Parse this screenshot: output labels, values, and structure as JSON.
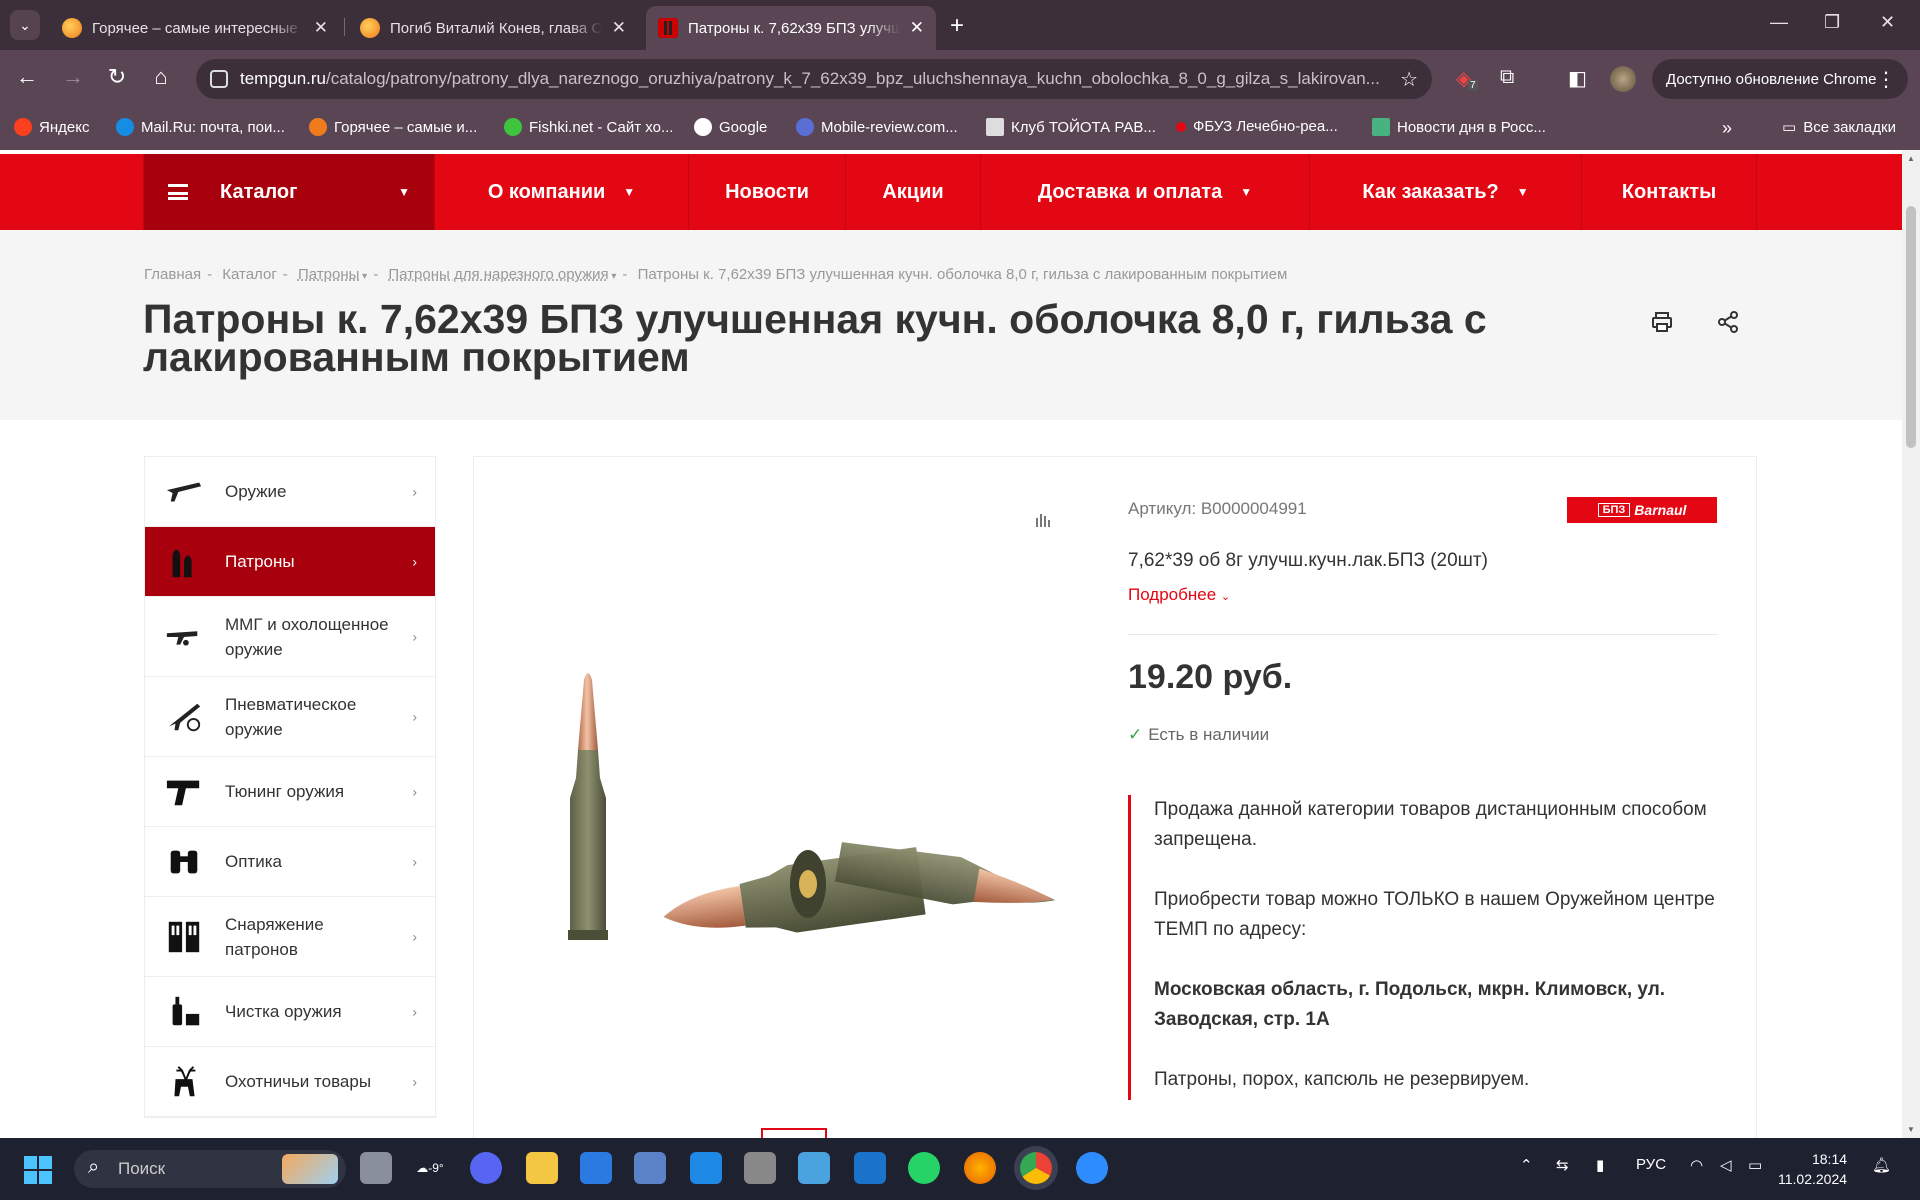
{
  "browser": {
    "tabs": [
      {
        "title": "Горячее – самые интересные п",
        "active": false
      },
      {
        "title": "Погиб Виталий Конев, глава С",
        "active": false
      },
      {
        "title": "Патроны к. 7,62х39 БПЗ улучш",
        "active": true
      }
    ],
    "url_host": "tempgun.ru",
    "url_path": "/catalog/patrony/patrony_dlya_nareznogo_oruzhiya/patrony_k_7_62x39_bpz_uluchshennaya_kuchn_obolochka_8_0_g_gilza_s_lakirovan...",
    "extension_badge": "7",
    "update_label": "Доступно обновление Chrome"
  },
  "bookmarks": [
    {
      "label": "Яндекс",
      "icon": "yandex-icon",
      "color": "#fc3f1d"
    },
    {
      "label": "Mail.Ru: почта, пои...",
      "icon": "mailru-icon",
      "color": "#168de2"
    },
    {
      "label": "Горячее – самые и...",
      "icon": "hot-icon",
      "color": "#f07b1d"
    },
    {
      "label": "Fishki.net - Сайт хо...",
      "icon": "fishki-icon",
      "color": "#3ec43e"
    },
    {
      "label": "Google",
      "icon": "globe-icon",
      "color": "#ffffff"
    },
    {
      "label": "Mobile-review.com...",
      "icon": "mobile-review-icon",
      "color": "#5a6fd6"
    },
    {
      "label": "Клуб ТОЙОТА РАВ...",
      "icon": "car-icon",
      "color": "#dddddd"
    },
    {
      "label": "ФБУЗ Лечебно-реа...",
      "icon": "fbuz-icon",
      "color": "#e30613"
    },
    {
      "label": "Новости дня в Росс...",
      "icon": "news-icon",
      "color": "#48b37e"
    }
  ],
  "bookmarks_all": "Все закладки",
  "site": {
    "nav": [
      {
        "label": "Каталог",
        "dropdown": true
      },
      {
        "label": "О компании",
        "dropdown": true
      },
      {
        "label": "Новости",
        "dropdown": false
      },
      {
        "label": "Акции",
        "dropdown": false
      },
      {
        "label": "Доставка и оплата",
        "dropdown": true
      },
      {
        "label": "Как заказать?",
        "dropdown": true
      },
      {
        "label": "Контакты",
        "dropdown": false
      }
    ],
    "breadcrumb": [
      "Главная",
      "Каталог",
      "Патроны",
      "Патроны для нарезного оружия",
      "Патроны к. 7,62х39 БПЗ улучшенная кучн. оболочка 8,0 г, гильза с лакированным покрытием"
    ],
    "title": "Патроны к. 7,62х39 БПЗ улучшенная кучн. оболочка 8,0 г, гильза с лакированным покрытием",
    "sidebar": [
      {
        "label": "Оружие",
        "active": false
      },
      {
        "label": "Патроны",
        "active": true
      },
      {
        "label": "ММГ и охолощенное оружие",
        "active": false
      },
      {
        "label": "Пневматическое оружие",
        "active": false
      },
      {
        "label": "Тюнинг оружия",
        "active": false
      },
      {
        "label": "Оптика",
        "active": false
      },
      {
        "label": "Снаряжение патронов",
        "active": false
      },
      {
        "label": "Чистка оружия",
        "active": false
      },
      {
        "label": "Охотничьи товары",
        "active": false
      }
    ],
    "product": {
      "sku": "Артикул: B0000004991",
      "brand": "Barnaul",
      "short_desc": "7,62*39 об 8г улучш.кучн.лак.БПЗ (20шт)",
      "more": "Подробнее",
      "price": "19.20 руб.",
      "stock": "Есть в наличии",
      "notice": [
        "Продажа данной категории товаров дистанционным способом запрещена.",
        "Приобрести товар можно ТОЛЬКО в нашем Оружейном центре ТЕМП по адресу:",
        "Московская область, г. Подольск, мкрн. Климовск, ул. Заводская, стр. 1А",
        "Патроны, порох, капсюль не резервируем."
      ]
    },
    "accent_color": "#e30613"
  },
  "taskbar": {
    "search_placeholder": "Поиск",
    "weather": "-9°",
    "lang": "РУС",
    "time": "18:14",
    "date": "11.02.2024"
  }
}
